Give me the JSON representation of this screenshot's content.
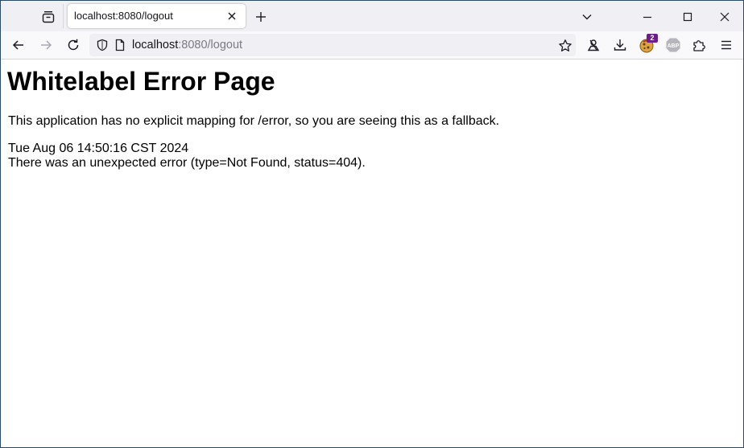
{
  "browser": {
    "tab": {
      "title": "localhost:8080/logout"
    },
    "urlbar": {
      "host": "localhost",
      "path": ":8080/logout"
    },
    "extension_badge": "2",
    "abp_label": "ABP"
  },
  "page": {
    "title": "Whitelabel Error Page",
    "description": "This application has no explicit mapping for /error, so you are seeing this as a fallback.",
    "timestamp": "Tue Aug 06 14:50:16 CST 2024",
    "error_message": "There was an unexpected error (type=Not Found, status=404)."
  },
  "icons": {
    "tab_groups": "tab-groups-icon",
    "tab_close": "close-icon",
    "new_tab": "plus-icon",
    "list_tabs": "chevron-down-icon",
    "minimize": "minimize-icon",
    "maximize": "maximize-icon",
    "close_window": "close-icon",
    "back": "arrow-left-icon",
    "forward": "arrow-right-icon",
    "reload": "reload-icon",
    "tracking_protection": "shield-icon",
    "page_info": "page-icon",
    "bookmark": "star-icon",
    "account": "account-icon",
    "downloads": "download-icon",
    "extension": "cookie-icon",
    "adblock": "abp-icon",
    "extensions": "puzzle-icon",
    "menu": "hamburger-menu-icon"
  },
  "colors": {
    "window_border": "#2b4a66",
    "tabstrip_bg": "#f0f0f4",
    "navbar_bg": "#f9f9fb",
    "badge_bg": "#6d1d8a"
  }
}
